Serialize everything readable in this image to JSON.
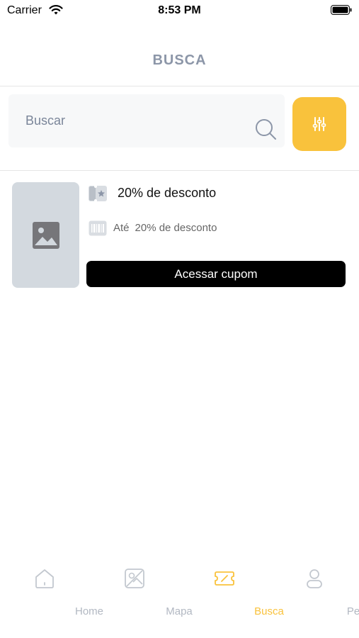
{
  "status_bar": {
    "carrier": "Carrier",
    "time": "8:53 PM"
  },
  "header": {
    "title": "BUSCA"
  },
  "search": {
    "placeholder": "Buscar",
    "value": ""
  },
  "coupon": {
    "title": "20% de desconto",
    "prefix": "Até",
    "description": "20% de desconto",
    "button_label": "Acessar cupom"
  },
  "tabs": [
    {
      "label": "Home",
      "icon": "home-icon",
      "active": false
    },
    {
      "label": "Mapa",
      "icon": "map-icon",
      "active": false
    },
    {
      "label": "Busca",
      "icon": "ticket-icon",
      "active": true
    },
    {
      "label": "Perfil",
      "icon": "user-icon",
      "active": false
    }
  ],
  "colors": {
    "accent": "#f9c23c",
    "title": "#8c96a8",
    "tab_inactive": "#b2b8c2",
    "button": "#000000"
  }
}
